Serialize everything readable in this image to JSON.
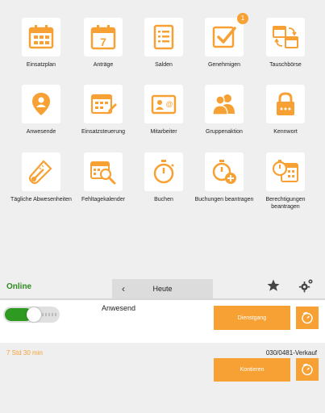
{
  "tiles": [
    {
      "label": "Einsatzplan",
      "icon": "calendar-grid-icon"
    },
    {
      "label": "Anträge",
      "icon": "calendar-seven-icon"
    },
    {
      "label": "Salden",
      "icon": "document-list-icon"
    },
    {
      "label": "Genehmigen",
      "icon": "checkbox-icon",
      "badge": "1"
    },
    {
      "label": "Tauschbörse",
      "icon": "calendar-swap-icon"
    },
    {
      "label": "Anwesende",
      "icon": "location-pin-icon"
    },
    {
      "label": "Einsatzsteuerung",
      "icon": "calendar-edit-icon"
    },
    {
      "label": "Mitarbeiter",
      "icon": "id-card-icon"
    },
    {
      "label": "Gruppenaktion",
      "icon": "group-icon"
    },
    {
      "label": "Kennwort",
      "icon": "lock-icon"
    },
    {
      "label": "Tägliche Abwesenheiten",
      "icon": "thermometer-icon"
    },
    {
      "label": "Fehltagekalender",
      "icon": "calendar-search-icon"
    },
    {
      "label": "Buchen",
      "icon": "stopwatch-icon"
    },
    {
      "label": "Buchungen beantragen",
      "icon": "stopwatch-add-icon"
    },
    {
      "label": "Berechtigungen beantragen",
      "icon": "calendar-stopwatch-icon"
    }
  ],
  "status": {
    "online": "Online"
  },
  "datenav": {
    "prev": "‹",
    "label": "Heute"
  },
  "booking": {
    "state": "Anwesend",
    "toggle_on": true,
    "dienstgang_label": "Dienstgang",
    "kontieren_label": "Kontieren",
    "duration": "7 Std 30 min",
    "account": "030/0481-Verkauf"
  },
  "colors": {
    "accent": "#f7a134",
    "online": "#2e8b1f",
    "toggle": "#2f9a21"
  }
}
